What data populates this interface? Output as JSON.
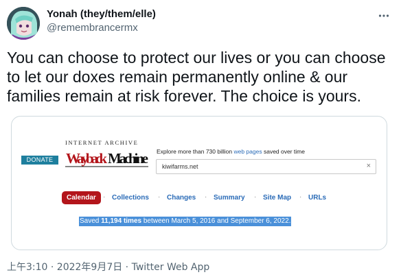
{
  "author": {
    "display_name": "Yonah (they/them/elle)",
    "handle": "@remembrancermx"
  },
  "tweet": {
    "text": "You can choose to protect our lives or you can choose to let our doxes remain permanently online & our families remain at risk forever. The choice is yours.",
    "timestamp": "上午3:10 · 2022年9月7日 · Twitter Web App"
  },
  "wayback": {
    "donate_label": "DONATE",
    "ia_text": "INTERNET ARCHIVE",
    "logo_text": "WaybackMachine",
    "explore_prefix": "Explore more than 730 billion",
    "explore_link": "web pages",
    "explore_suffix": "saved over time",
    "url_value": "kiwifarms.net",
    "clear_glyph": "×",
    "nav": [
      "Calendar",
      "Collections",
      "Changes",
      "Summary",
      "Site Map",
      "URLs"
    ],
    "nav_separator": "·",
    "saved_prefix": "Saved",
    "saved_count": "11,194 times",
    "saved_suffix": "between March 5, 2016 and September 6, 2022."
  },
  "colors": {
    "donate_bg": "#1e7f9e",
    "logo_red": "#b3151b",
    "link_blue": "#2a6bb7",
    "selection_bg": "#4a90d9"
  }
}
